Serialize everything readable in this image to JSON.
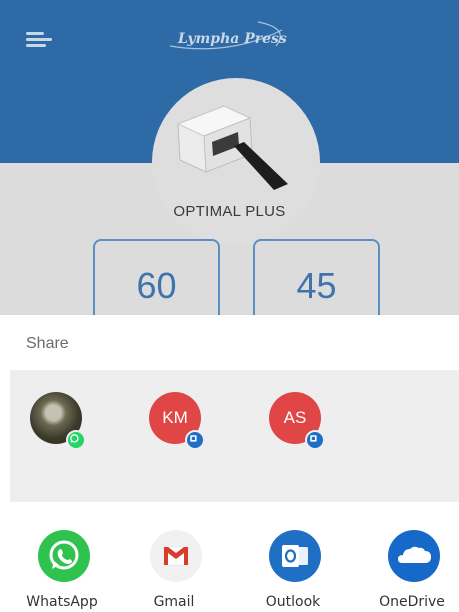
{
  "app": {
    "brand": "Lympha Press",
    "device_name": "OPTIMAL PLUS",
    "stats": [
      "60",
      "45"
    ],
    "colors": {
      "header": "#2e6aa6",
      "accent": "#3f73ab"
    }
  },
  "share": {
    "title": "Share",
    "contacts": [
      {
        "initials": "",
        "avatar": "photo",
        "badge": "whatsapp-badge-icon"
      },
      {
        "initials": "KM",
        "avatar": "red",
        "badge": "outlook-badge-icon"
      },
      {
        "initials": "AS",
        "avatar": "red",
        "badge": "outlook-badge-icon"
      }
    ],
    "apps": [
      {
        "label": "WhatsApp",
        "icon": "whatsapp-icon"
      },
      {
        "label": "Gmail",
        "icon": "gmail-icon"
      },
      {
        "label": "Outlook",
        "icon": "outlook-icon"
      },
      {
        "label": "OneDrive",
        "icon": "onedrive-icon"
      }
    ]
  }
}
